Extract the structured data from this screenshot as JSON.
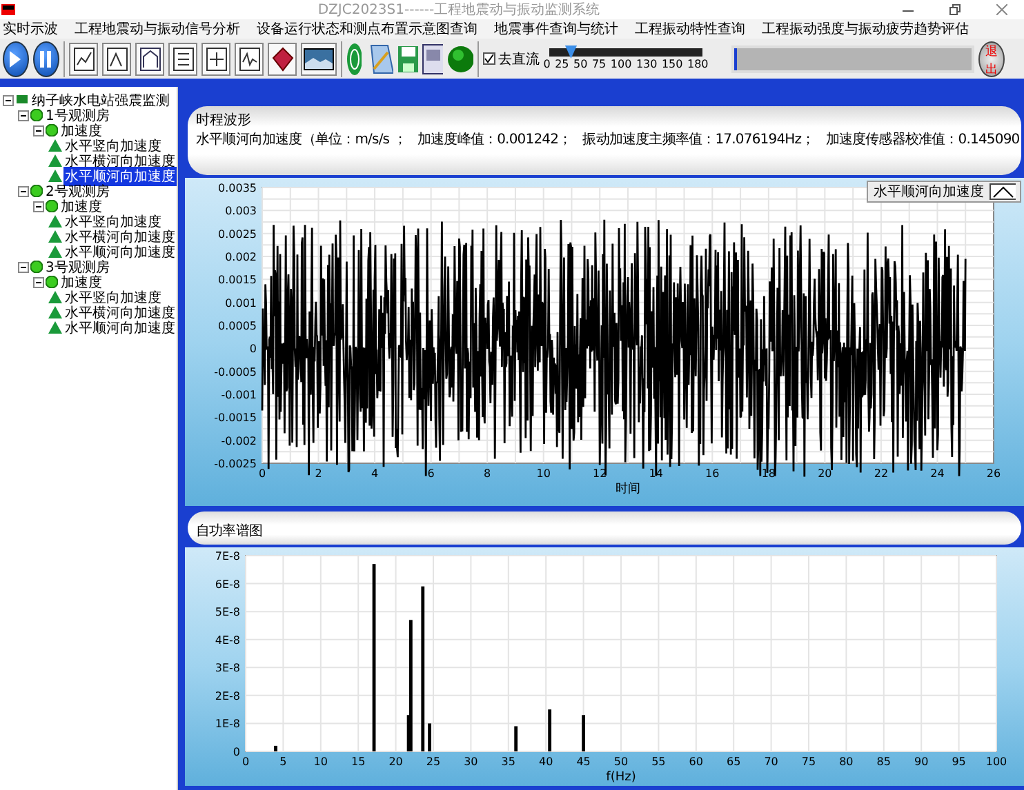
{
  "window": {
    "title": "DZJC2023S1------工程地震动与振动监测系统"
  },
  "menu": [
    "实时示波",
    "工程地震动与振动信号分析",
    "设备运行状态和测点布置示意图查询",
    "地震事件查询与统计",
    "工程振动特性查询",
    "工程振动强度与振动疲劳趋势评估"
  ],
  "toolbar": {
    "dc_filter": {
      "label": "去直流",
      "checked": true
    },
    "slider": {
      "ticks": [
        "0",
        "25",
        "50",
        "75",
        "100",
        "130",
        "150",
        "180"
      ],
      "level": 0.139
    },
    "progress": {
      "level": 0.005
    },
    "exit_button": "退出"
  },
  "tree": {
    "label": "纳子峡水电站强震监测",
    "expanded": true,
    "selected": false,
    "children": [
      {
        "label": "1号观测房",
        "expanded": true,
        "selected": false,
        "children": [
          {
            "label": "加速度",
            "expanded": true,
            "selected": false,
            "children": [
              {
                "label": "水平竖向加速度",
                "selected": false
              },
              {
                "label": "水平横河向加速度",
                "selected": false
              },
              {
                "label": "水平顺河向加速度",
                "selected": true
              }
            ]
          }
        ]
      },
      {
        "label": "2号观测房",
        "expanded": true,
        "selected": false,
        "children": [
          {
            "label": "加速度",
            "expanded": true,
            "selected": false,
            "children": [
              {
                "label": "水平竖向加速度",
                "selected": false
              },
              {
                "label": "水平横河向加速度",
                "selected": false
              },
              {
                "label": "水平顺河向加速度",
                "selected": false
              }
            ]
          }
        ]
      },
      {
        "label": "3号观测房",
        "expanded": true,
        "selected": false,
        "children": [
          {
            "label": "加速度",
            "expanded": true,
            "selected": false,
            "children": [
              {
                "label": "水平竖向加速度",
                "selected": false
              },
              {
                "label": "水平横河向加速度",
                "selected": false
              },
              {
                "label": "水平顺河向加速度",
                "selected": false
              }
            ]
          }
        ]
      }
    ]
  },
  "info_panel": {
    "title": "时程波形",
    "fields": [
      "水平顺河向加速度（单位：m/s/s ；",
      "加速度峰值：0.001242；",
      "振动加速度主频率值：17.076194Hz；",
      "加速度传感器校准值：0.145090"
    ]
  },
  "time_chart": {
    "legend": "水平顺河向加速度",
    "xlabel": "时间",
    "xticks": [
      "0",
      "2",
      "4",
      "6",
      "8",
      "10",
      "12",
      "14",
      "16",
      "18",
      "20",
      "22",
      "24",
      "26"
    ],
    "yticks": [
      "0.0035",
      "0.003",
      "0.0025",
      "0.002",
      "0.0015",
      "0.001",
      "0.0005",
      "0",
      "-0.0005",
      "-0.001",
      "-0.0015",
      "-0.002",
      "-0.0025"
    ]
  },
  "spectrum_panel": {
    "title": "自功率谱图"
  },
  "spectrum_chart": {
    "chart_data": {
      "type": "bar",
      "grid": true,
      "xlabel": "f(Hz)",
      "x": [
        4,
        17.1,
        21.7,
        22,
        23.6,
        24.5,
        36,
        40.5,
        45
      ],
      "values": [
        2e-09,
        6.7e-08,
        1.3e-08,
        4.7e-08,
        5.9e-08,
        1e-08,
        9e-09,
        1.5e-08,
        1.3e-08
      ],
      "xlim": [
        0,
        100
      ],
      "ylim": [
        0,
        7e-08
      ],
      "xticks": [
        0,
        5,
        10,
        15,
        20,
        25,
        30,
        35,
        40,
        45,
        50,
        55,
        60,
        65,
        70,
        75,
        80,
        85,
        90,
        95,
        100
      ],
      "yticks": [
        {
          "value": 0,
          "label": "0"
        },
        {
          "value": 1e-08,
          "label": "1E-8"
        },
        {
          "value": 2e-08,
          "label": "2E-8"
        },
        {
          "value": 3e-08,
          "label": "3E-8"
        },
        {
          "value": 4e-08,
          "label": "4E-8"
        },
        {
          "value": 5e-08,
          "label": "5E-8"
        },
        {
          "value": 6e-08,
          "label": "6E-8"
        },
        {
          "value": 7e-08,
          "label": "7E-8"
        }
      ]
    }
  }
}
